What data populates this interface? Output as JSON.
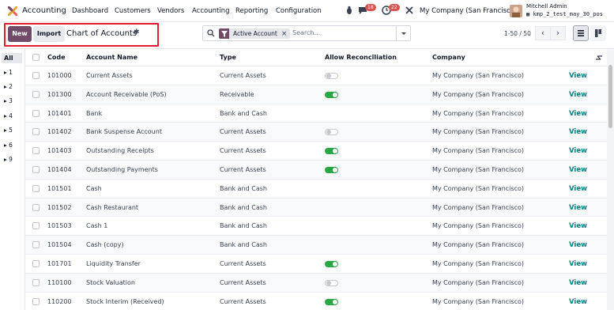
{
  "navbar": {
    "app_name": "Accounting",
    "menus": [
      "Dashboard",
      "Customers",
      "Vendors",
      "Accounting",
      "Reporting",
      "Configuration"
    ],
    "messages_count": "18",
    "activities_count": "22",
    "company": "My Company (San Francisco)",
    "user_name": "Mitchell Admin",
    "db_name": "kmp_2_test_may_30_pos"
  },
  "control": {
    "new_label": "New",
    "import_label": "Import",
    "title": "Chart of Accounts",
    "facet_label": "Active Account",
    "search_placeholder": "Search...",
    "pager": "1-50 / 50"
  },
  "sidebar": {
    "all_label": "All",
    "items": [
      "1",
      "2",
      "3",
      "4",
      "5",
      "6",
      "9"
    ]
  },
  "table": {
    "headers": {
      "code": "Code",
      "name": "Account Name",
      "type": "Type",
      "reconcile": "Allow Reconciliation",
      "company": "Company"
    },
    "view_label": "View",
    "rows": [
      {
        "code": "101000",
        "name": "Current Assets",
        "type": "Current Assets",
        "reconcile": "off",
        "company": "My Company (San Francisco)"
      },
      {
        "code": "101300",
        "name": "Account Receivable (PoS)",
        "type": "Receivable",
        "reconcile": "on",
        "company": "My Company (San Francisco)"
      },
      {
        "code": "101401",
        "name": "Bank",
        "type": "Bank and Cash",
        "reconcile": "none",
        "company": "My Company (San Francisco)"
      },
      {
        "code": "101402",
        "name": "Bank Suspense Account",
        "type": "Current Assets",
        "reconcile": "off",
        "company": "My Company (San Francisco)"
      },
      {
        "code": "101403",
        "name": "Outstanding Receipts",
        "type": "Current Assets",
        "reconcile": "on",
        "company": "My Company (San Francisco)"
      },
      {
        "code": "101404",
        "name": "Outstanding Payments",
        "type": "Current Assets",
        "reconcile": "on",
        "company": "My Company (San Francisco)"
      },
      {
        "code": "101501",
        "name": "Cash",
        "type": "Bank and Cash",
        "reconcile": "none",
        "company": "My Company (San Francisco)"
      },
      {
        "code": "101502",
        "name": "Cash Restaurant",
        "type": "Bank and Cash",
        "reconcile": "none",
        "company": "My Company (San Francisco)"
      },
      {
        "code": "101503",
        "name": "Cash 1",
        "type": "Bank and Cash",
        "reconcile": "none",
        "company": "My Company (San Francisco)"
      },
      {
        "code": "101504",
        "name": "Cash (copy)",
        "type": "Bank and Cash",
        "reconcile": "none",
        "company": "My Company (San Francisco)"
      },
      {
        "code": "101701",
        "name": "Liquidity Transfer",
        "type": "Current Assets",
        "reconcile": "on",
        "company": "My Company (San Francisco)"
      },
      {
        "code": "110100",
        "name": "Stock Valuation",
        "type": "Current Assets",
        "reconcile": "off",
        "company": "My Company (San Francisco)"
      },
      {
        "code": "110200",
        "name": "Stock Interim (Received)",
        "type": "Current Assets",
        "reconcile": "on",
        "company": "My Company (San Francisco)"
      }
    ]
  },
  "colors": {
    "brand": "#714b67",
    "toggle_on": "#28a745",
    "link": "#017e84",
    "highlight": "#e11d2f"
  }
}
